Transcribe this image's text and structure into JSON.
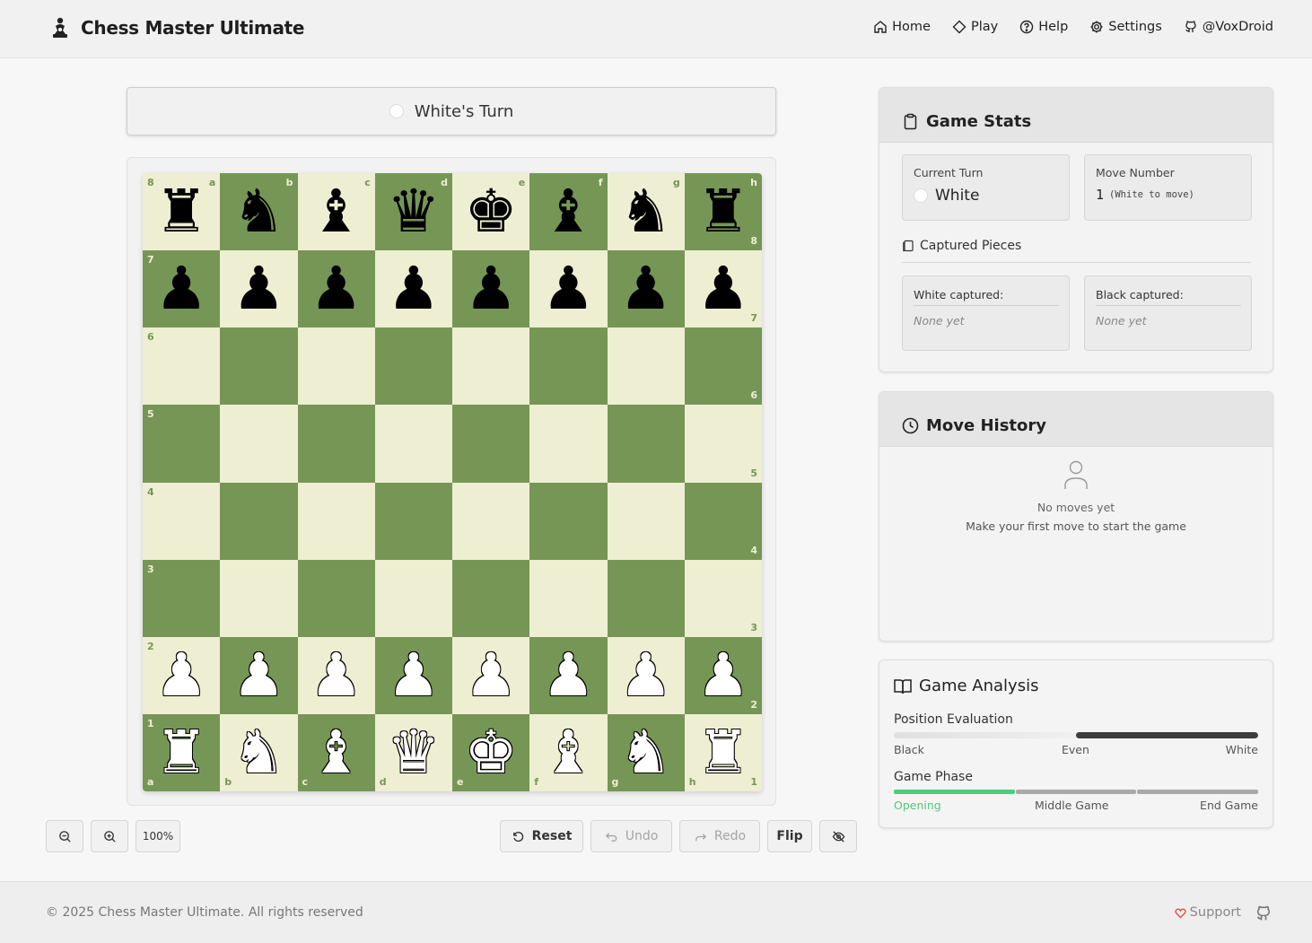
{
  "app": {
    "title": "Chess Master Ultimate"
  },
  "nav": [
    {
      "label": "Home",
      "icon": "home-icon"
    },
    {
      "label": "Play",
      "icon": "diamond-icon"
    },
    {
      "label": "Help",
      "icon": "help-circle-icon"
    },
    {
      "label": "Settings",
      "icon": "gear-icon"
    },
    {
      "label": "@VoxDroid",
      "icon": "github-icon"
    }
  ],
  "turn_banner": "White's Turn",
  "board": {
    "files": [
      "a",
      "b",
      "c",
      "d",
      "e",
      "f",
      "g",
      "h"
    ],
    "ranks": [
      "8",
      "7",
      "6",
      "5",
      "4",
      "3",
      "2",
      "1"
    ],
    "position": [
      [
        "br",
        "bn",
        "bb",
        "bq",
        "bk",
        "bb",
        "bn",
        "br"
      ],
      [
        "bp",
        "bp",
        "bp",
        "bp",
        "bp",
        "bp",
        "bp",
        "bp"
      ],
      [
        "",
        "",
        "",
        "",
        "",
        "",
        "",
        ""
      ],
      [
        "",
        "",
        "",
        "",
        "",
        "",
        "",
        ""
      ],
      [
        "",
        "",
        "",
        "",
        "",
        "",
        "",
        ""
      ],
      [
        "",
        "",
        "",
        "",
        "",
        "",
        "",
        ""
      ],
      [
        "wp",
        "wp",
        "wp",
        "wp",
        "wp",
        "wp",
        "wp",
        "wp"
      ],
      [
        "wr",
        "wn",
        "wb",
        "wq",
        "wk",
        "wb",
        "wn",
        "wr"
      ]
    ],
    "colors": {
      "light": "#eeeed2",
      "dark": "#769656"
    }
  },
  "controls": {
    "zoom": "100%",
    "reset": "Reset",
    "undo": "Undo",
    "redo": "Redo",
    "flip": "Flip"
  },
  "stats": {
    "title": "Game Stats",
    "current_turn_label": "Current Turn",
    "current_turn_value": "White",
    "move_number_label": "Move Number",
    "move_number_value": "1",
    "move_number_sub": "(White to move)",
    "captured_title": "Captured Pieces",
    "white_captured_label": "White captured:",
    "white_captured_value": "None yet",
    "black_captured_label": "Black captured:",
    "black_captured_value": "None yet"
  },
  "history": {
    "title": "Move History",
    "empty_line1": "No moves yet",
    "empty_line2": "Make your first move to start the game"
  },
  "analysis": {
    "title": "Game Analysis",
    "eval_label": "Position Evaluation",
    "eval_white_fraction": 0.5,
    "eval_left": "Black",
    "eval_mid": "Even",
    "eval_right": "White",
    "phase_label": "Game Phase",
    "phases": [
      "Opening",
      "Middle Game",
      "End Game"
    ],
    "active_phase": 0,
    "accent": "#4ccc7d"
  },
  "footer": {
    "copyright": "© 2025 Chess Master Ultimate. All rights reserved",
    "support": "Support"
  }
}
